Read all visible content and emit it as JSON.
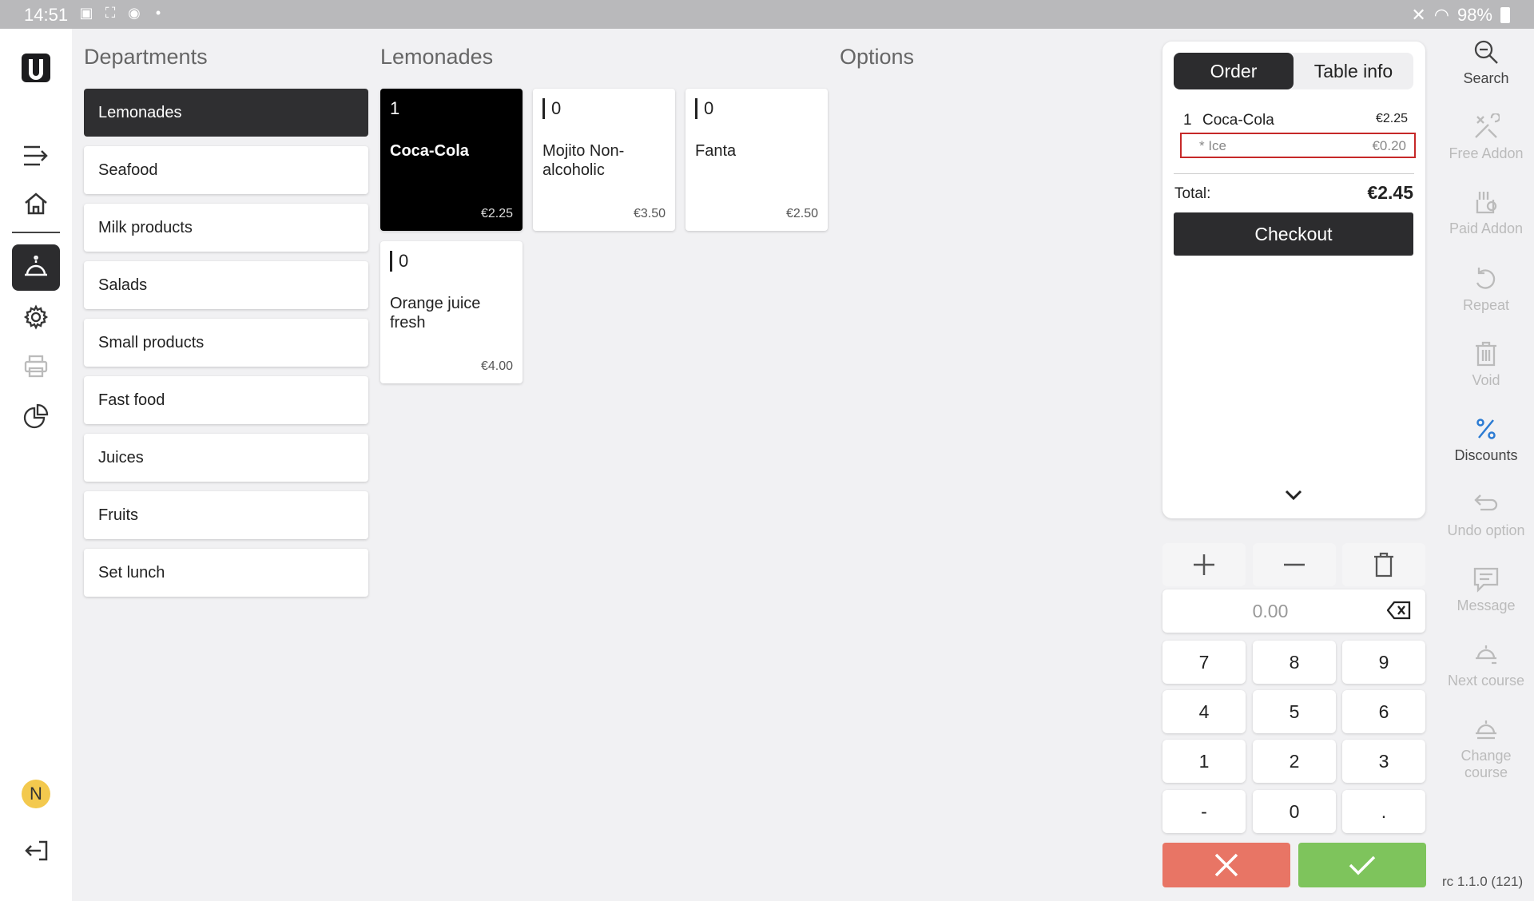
{
  "status_bar": {
    "time": "14:51",
    "battery": "98%"
  },
  "departments": {
    "title": "Departments",
    "items": [
      {
        "label": "Lemonades"
      },
      {
        "label": "Seafood"
      },
      {
        "label": "Milk products"
      },
      {
        "label": "Salads"
      },
      {
        "label": "Small products"
      },
      {
        "label": "Fast food"
      },
      {
        "label": "Juices"
      },
      {
        "label": "Fruits"
      },
      {
        "label": "Set lunch"
      }
    ],
    "selected": "Lemonades"
  },
  "products": {
    "title": "Lemonades",
    "items": [
      {
        "qty": "1",
        "name": "Coca-Cola",
        "price": "€2.25"
      },
      {
        "qty": "0",
        "name": "Mojito Non-alcoholic",
        "price": "€3.50"
      },
      {
        "qty": "0",
        "name": "Fanta",
        "price": "€2.50"
      },
      {
        "qty": "0",
        "name": "Orange juice fresh",
        "price": "€4.00"
      }
    ]
  },
  "options": {
    "title": "Options"
  },
  "order": {
    "tabs": [
      "Order",
      "Table info"
    ],
    "line": {
      "qty": "1",
      "name": "Coca-Cola",
      "price": "€2.25"
    },
    "addon": {
      "name": "* Ice",
      "price": "€0.20"
    },
    "total_label": "Total:",
    "total_value": "€2.45",
    "checkout_label": "Checkout"
  },
  "keypad": {
    "display": "0.00",
    "keys": [
      "7",
      "8",
      "9",
      "4",
      "5",
      "6",
      "1",
      "2",
      "3",
      "-",
      "0",
      "."
    ]
  },
  "actions": [
    {
      "label": "Search",
      "icon": "search-icon"
    },
    {
      "label": "Free Addon",
      "icon": "free-addon-icon"
    },
    {
      "label": "Paid Addon",
      "icon": "paid-addon-icon"
    },
    {
      "label": "Repeat",
      "icon": "repeat-icon"
    },
    {
      "label": "Void",
      "icon": "trash-icon"
    },
    {
      "label": "Discounts",
      "icon": "percent-icon"
    },
    {
      "label": "Undo option",
      "icon": "undo-icon"
    },
    {
      "label": "Message",
      "icon": "message-icon"
    },
    {
      "label": "Next course",
      "icon": "next-course-icon"
    },
    {
      "label": "Change",
      "label2": "course",
      "icon": "change-course-icon"
    }
  ],
  "version": "rc 1.1.0 (121)",
  "user_initial": "N",
  "colors": {
    "dark": "#2c2c2e",
    "cancel": "#e87565",
    "confirm": "#7ec45c",
    "highlight": "#c62828",
    "discount_blue": "#2b7bd3"
  }
}
